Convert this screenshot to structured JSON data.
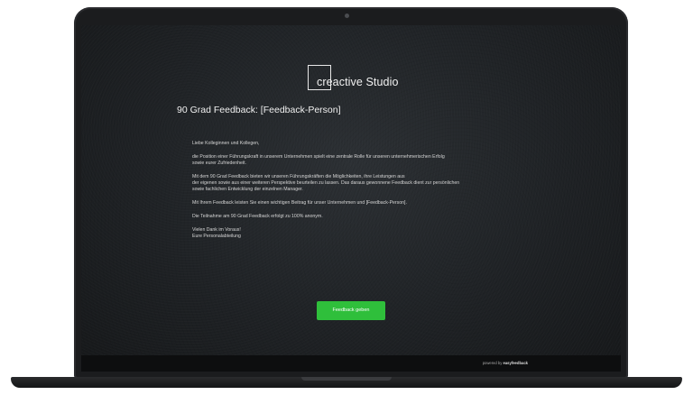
{
  "logo": {
    "text": "creactive Studio"
  },
  "page": {
    "title": "90 Grad Feedback: [Feedback-Person]"
  },
  "body": {
    "greeting": "Liebe Kolleginnen und Kollegen,",
    "para1": [
      "die Position einer Führungskraft in unserem Unternehmen spielt eine zentrale Rolle für unseren unternehmerischen Erfolg",
      "sowie eurer Zufriedenheit."
    ],
    "para2": [
      "Mit dem 90 Grad Feedback bieten wir unseren Führungskräften die Möglichkeiten, ihre Leistungen aus",
      "der eigenen sowie aus einer weiteren Perspektive beurteilen zu lassen. Das daraus gewonnene Feedback dient zur persönlichen",
      "sowie fachlichen Entwicklung der einzelnen Manager."
    ],
    "para3": "Mit Ihrem Feedback leisten Sie einen wichtigen Beitrag für unser Unternehmen und [Feedback-Person].",
    "para4": "Die Teilnahme am 90 Grad Feedback erfolgt zu 100% anonym.",
    "closing": [
      "Vielen Dank im Voraus!",
      "Eure Personalabteilung"
    ]
  },
  "cta": {
    "label": "Feedback geben"
  },
  "footer": {
    "powered_prefix": "powered by",
    "powered_brand": "easyfeedback"
  },
  "colors": {
    "accent": "#2fbf3b",
    "screen_bg": "#1e2124",
    "bezel": "#1b1c1e"
  }
}
